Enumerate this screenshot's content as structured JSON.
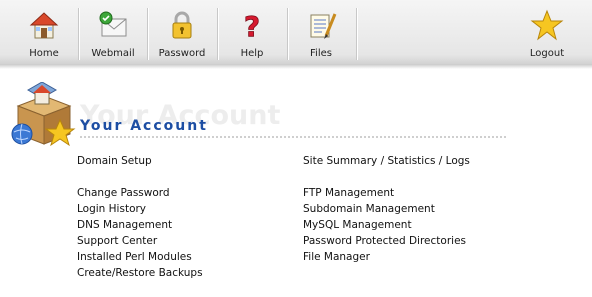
{
  "toolbar": {
    "items": [
      {
        "label": "Home",
        "icon": "home-icon"
      },
      {
        "label": "Webmail",
        "icon": "webmail-icon"
      },
      {
        "label": "Password",
        "icon": "lock-icon"
      },
      {
        "label": "Help",
        "icon": "question-mark-icon"
      },
      {
        "label": "Files",
        "icon": "files-icon"
      },
      {
        "label": "Logout",
        "icon": "star-icon"
      }
    ]
  },
  "section": {
    "watermark": "Your Account",
    "title": "Your Account",
    "icon": "account-box-icon"
  },
  "links": {
    "left": [
      "Domain Setup",
      "Change Password",
      "Login History",
      "DNS Management",
      "Support Center",
      "Installed Perl Modules",
      "Create/Restore Backups"
    ],
    "right": [
      "Site Summary / Statistics / Logs",
      "FTP Management",
      "Subdomain Management",
      "MySQL Management",
      "Password Protected Directories",
      "File Manager"
    ]
  },
  "colors": {
    "title": "#1d4ea3",
    "watermark": "#ededed",
    "toolbar": "#e6e6e6"
  }
}
